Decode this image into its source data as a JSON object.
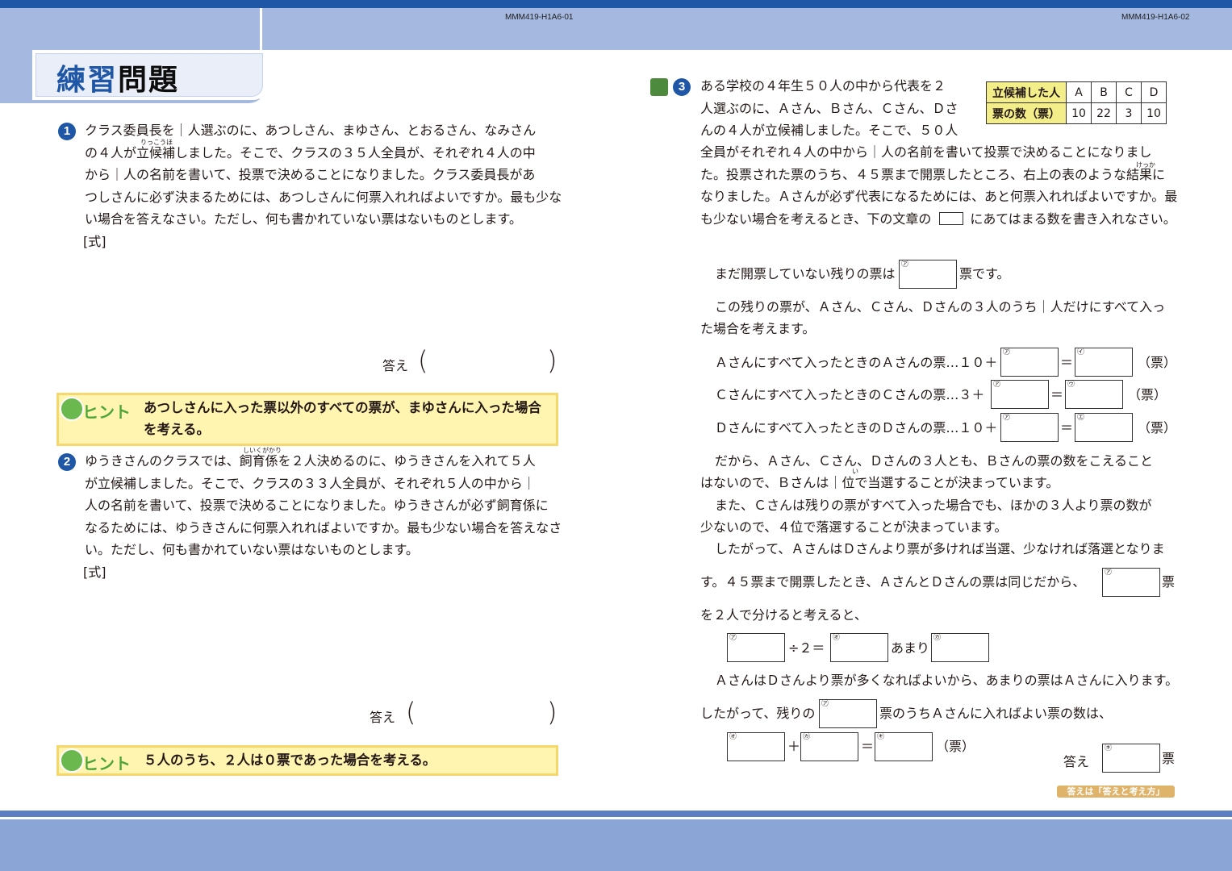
{
  "header": {
    "code_left": "MMM419-H1A6-01",
    "code_right": "MMM419-H1A6-02",
    "title_part1": "練習",
    "title_part2": "問題"
  },
  "q1": {
    "number": "1",
    "lines": [
      "クラス委員長を｜人選ぶのに、あつしさん、まゆさん、とおるさん、なみさん",
      "の４人が立候補しました。そこで、クラスの３５人全員が、それぞれ４人の中",
      "から｜人の名前を書いて、投票で決めることになりました。クラス委員長があ",
      "つしさんに必ず決まるためには、あつしさんに何票入れればよいですか。最も少な",
      "い場合を答えなさい。ただし、何も書かれていない票はないものとします。"
    ],
    "ruby": "りっこうほ",
    "formula_label": "[式]",
    "answer_label": "答え",
    "paren_open": "(",
    "paren_close": ")"
  },
  "hint1": {
    "badge": "ヒント",
    "lines": [
      "あつしさんに入った票以外のすべての票が、まゆさんに入った場合",
      "を考える。"
    ]
  },
  "q2": {
    "number": "2",
    "lines": [
      "ゆうきさんのクラスでは、飼育係を２人決めるのに、ゆうきさんを入れて５人",
      "が立候補しました。そこで、クラスの３３人全員が、それぞれ５人の中から｜",
      "人の名前を書いて、投票で決めることになりました。ゆうきさんが必ず飼育係に",
      "なるためには、ゆうきさんに何票入れればよいですか。最も少ない場合を答えなさ",
      "い。ただし、何も書かれていない票はないものとします。"
    ],
    "ruby": "しいくがかり",
    "formula_label": "[式]",
    "answer_label": "答え",
    "paren_open": "(",
    "paren_close": ")"
  },
  "hint2": {
    "badge": "ヒント",
    "lines": [
      "５人のうち、２人は０票であった場合を考える。"
    ]
  },
  "q3": {
    "number": "3",
    "lines_top": [
      "ある学校の４年生５０人の中から代表を２",
      "人選ぶのに、Ａさん、Ｂさん、Ｃさん、Ｄさ",
      "んの４人が立候補しました。そこで、５０人"
    ],
    "lines_full": [
      "全員がそれぞれ４人の中から｜人の名前を書いて投票で決めることになりまし",
      "た。投票された票のうち、４５票まで開票したところ、右上の表のような結果に",
      "なりました。Ａさんが必ず代表になるためには、あと何票入れればよいですか。最",
      "も少ない場合を考えるとき、下の文章の　　　にあてはまる数を書き入れなさい。"
    ],
    "ruby_kekka": "けっか",
    "table": {
      "header": [
        "立候補した人",
        "A",
        "B",
        "C",
        "D"
      ],
      "row": [
        "票の数（票）",
        "10",
        "22",
        "3",
        "10"
      ]
    },
    "s1a": "まだ開票していない残りの票は",
    "s1b": "票です。",
    "s2a": "この残りの票が、Ａさん、Ｃさん、Ｄさんの３人のうち｜人だけにすべて入っ",
    "s2b": "た場合を考えます。",
    "sA": "Ａさんにすべて入ったときのＡさんの票…１０＋",
    "sC": "Ｃさんにすべて入ったときのＣさんの票…３＋",
    "sD": "Ｄさんにすべて入ったときのＤさんの票…１０＋",
    "eq": "＝",
    "unit_paren": "（票）",
    "s3a": "だから、Ａさん、Ｃさん、Ｄさんの３人とも、Ｂさんの票の数をこえること",
    "s3b": "はないので、Ｂさんは｜位で当選することが決まっています。",
    "ruby_i": "い",
    "s4a": "また、Ｃさんは残りの票がすべて入った場合でも、ほかの３人より票の数が",
    "s4b": "少ないので、４位で落選することが決まっています。",
    "s5a": "したがって、ＡさんはＤさんより票が多ければ当選、少なければ落選となりま",
    "s5b": "す。４５票まで開票したとき、ＡさんとＤさんの票は同じだから、",
    "s5c": "票",
    "s6": "を２人で分けると考えると、",
    "div": "÷２＝",
    "amari": "あまり",
    "s7": "ＡさんはＤさんより票が多くなればよいから、あまりの票はＡさんに入ります。",
    "s8a": "したがって、残りの",
    "s8b": "票のうちＡさんに入ればよい票の数は、",
    "plus": "＋",
    "answer_label": "答え",
    "answer_unit": "票",
    "marks": {
      "a": "㋐",
      "i": "㋑",
      "u": "㋒",
      "e": "㋓",
      "o": "㋔",
      "ka": "㋕",
      "ki": "㋖"
    }
  },
  "footer": {
    "answer_key": "答えは「答えと考え方」"
  },
  "colors": {
    "accent": "#1f57a6",
    "band": "#a5b9e0",
    "hint_bg": "#fff5b0",
    "table_header": "#f3ee8a"
  }
}
